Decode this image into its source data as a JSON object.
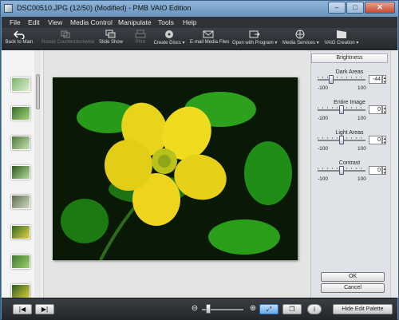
{
  "window": {
    "title": "DSC00510.JPG (12/50) (Modified) - PMB VAIO Edition",
    "minimize": "–",
    "maximize": "□",
    "close": "✕"
  },
  "menu": [
    "File",
    "Edit",
    "View",
    "Media Control",
    "Manipulate",
    "Tools",
    "Help"
  ],
  "toolbar": {
    "back": "Back to Main",
    "rotate": "Rotate Counterclockwise",
    "slideshow": "Slide Show",
    "print": "Print",
    "create_discs": "Create Discs ▾",
    "email": "E-mail Media Files",
    "open_with": "Open with Program ▾",
    "media_services": "Media Services ▾",
    "vaio_creation": "VAIO Creation ▾"
  },
  "panel": {
    "header": "Brightness",
    "dark_areas": {
      "label": "Dark Areas",
      "value": "-44",
      "min": "-100",
      "max": "100",
      "level": -44
    },
    "entire_image": {
      "label": "Entire Image",
      "value": "0",
      "min": "-100",
      "max": "100",
      "level": 0
    },
    "light_areas": {
      "label": "Light Areas",
      "value": "0",
      "min": "-100",
      "max": "100",
      "level": 0
    },
    "contrast": {
      "label": "Contrast",
      "value": "0",
      "min": "-100",
      "max": "100",
      "level": 0
    },
    "ok": "OK",
    "cancel": "Cancel"
  },
  "statusbar": {
    "prev": "|◀",
    "next": "▶|",
    "zoom_out": "⊖",
    "zoom_in": "⊕",
    "fit": "⤢",
    "compare": "❐",
    "info": "i",
    "hide_palette": "Hide Edit Palette"
  },
  "colors": {
    "menubar": "#2f3338",
    "toolbar": "#2b2f34",
    "selected": "#6aa9e6"
  }
}
